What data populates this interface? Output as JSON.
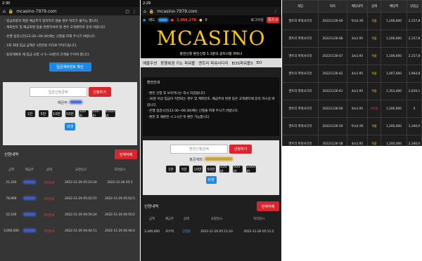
{
  "panel1": {
    "status_time": "2:30",
    "url": "mcasino-7979.com",
    "notice_lines": [
      "- 입금자명과 회원 예금주가 일치하지 않을 경우 처리가 불가능 합니다.",
      "- 계좌번호 및 예금자명 등을 변경하셔야 할 경우 고객센터로 문의 바랍니다.",
      "",
      "- 은행 점검시간(23:30~00:30)에는 신청을 피해 주시기 바랍니다.",
      "",
      "- 1회 최대 입금 금액은 1천만원 이하로 부탁드립니다.",
      "",
      "- 동일계좌로 재 입금 요청 시 5~10분의 간격을 두어야 합니다."
    ],
    "account_button": "입금계좌번호 확인",
    "amount_placeholder": "입금신청금액",
    "apply_button": "신청하기",
    "holder_label": "예금주:",
    "amount_buttons": [
      "1만",
      "5만",
      "10만",
      "50만",
      "100만",
      "500만",
      "1000만"
    ],
    "reset_button": "리셋",
    "history_title": "신청내역",
    "delete_all_button": "전체삭제",
    "columns": [
      "금액",
      "예금주",
      "상태",
      "요청일시",
      "처리일시"
    ],
    "rows": [
      {
        "amount": "21,160",
        "status": "처리완료",
        "requested": "2022-11-26 05:10:24",
        "processed": "2022-11-26 05:1"
      },
      {
        "amount": "78,966",
        "status": "처리완료",
        "requested": "2022-11-26 05:02:51",
        "processed": "2022-11-26 05:02:5"
      },
      {
        "amount": "22,100",
        "status": "처리완료",
        "requested": "2022-11-26 04:50:24",
        "processed": "2022-11-26 04:50:2"
      },
      {
        "amount": "3,000,000",
        "status": "처리완료",
        "requested": "2022-11-26 04:44:11",
        "processed": "2022-11-26 04:44:4"
      }
    ]
  },
  "panel2": {
    "status_time": "2:29",
    "url": "mcasino-7979.com",
    "user_label": "배드",
    "points": "3,004,276",
    "coin": "0",
    "logout": "로그아웃",
    "msg_badge": "쪽지 0",
    "logo": "MCASINO",
    "sub_banner": "충전신청 환전신청 1:1문의 공지사항 파트너",
    "menu": [
      "예울우션",
      "동행복권 키노 파워볼",
      "엔트리 파워사다리",
      "EOS파워볼3",
      "EO"
    ],
    "section_title": "환전안내",
    "notice_lines": [
      "- 환전 신청 후 보유머니는 즉시 차감됩니다.",
      "- 30분 이상 입금이 지연되는 경우 및 계좌번호, 예금주의 변경 등은 고객센터에 문의 하시길 바랍니다.",
      "- 은행 점검시간(23:30~00:30)에는 신청을 피해 주시기 바랍니다.",
      "- 환전 후 재환전 시 1시간 뒤 환전 가능합니다."
    ],
    "amount_placeholder": "환전신청금액",
    "apply_button": "신청하기",
    "account_label": "출금계좌:",
    "amount_buttons": [
      "1만",
      "5만",
      "10만",
      "50만",
      "100만",
      "500만",
      "1000만"
    ],
    "reset_button": "리셋",
    "history_title": "신청내역",
    "delete_all_button": "전체삭제",
    "columns": [
      "금액",
      "예금주",
      "상태",
      "요청일시",
      "처리일시"
    ],
    "rows": [
      {
        "amount": "3,340,000",
        "holder": "조수혁",
        "status": "신청중",
        "requested": "2022-11-26 05:11:43",
        "processed": "2022-11-26 05:11:5"
      }
    ]
  },
  "panel3": {
    "columns": [
      "게임",
      "회차",
      "배팅내역",
      "상태",
      "배팅액",
      "당첨금"
    ],
    "rows": [
      {
        "game": "엔트리 파워사다리",
        "round": "20221126-69",
        "bet": "우/x1.95",
        "status": "적중",
        "stake": "1,106,600",
        "win": "2,157,8"
      },
      {
        "game": "엔트리 파워사다리",
        "round": "20221126-68",
        "bet": "3/x1.95",
        "status": "적중",
        "stake": "1,106,600",
        "win": "2,157,8"
      },
      {
        "game": "엔트리 파워사다리",
        "round": "20221126-67",
        "bet": "3/x1.95",
        "status": "적중",
        "stake": "1,106,600",
        "win": "2,157,8"
      },
      {
        "game": "엔트리 파워사다리",
        "round": "20221126-62",
        "bet": "4/x1.95",
        "status": "적중",
        "stake": "1,007,600",
        "win": "1,964,8"
      },
      {
        "game": "엔트리 파워사다리",
        "round": "20221126-61",
        "bet": "4/x1.95",
        "status": "적중",
        "stake": "1,353,400",
        "win": "2,639,1"
      },
      {
        "game": "엔트리 파워사다리",
        "round": "20221126-60",
        "bet": "4/x1.95",
        "status": "미적중",
        "stake": "1,206,900",
        "win": "0"
      },
      {
        "game": "엔트리 파워사다리",
        "round": "20221126-59",
        "bet": "우/x1.95",
        "status": "적중",
        "stake": "1,200,000",
        "win": "2,340,0"
      },
      {
        "game": "엔트리 파워사다리",
        "round": "20221126-58",
        "bet": "4/x1.95",
        "status": "적중",
        "stake": "1,200,000",
        "win": "2,340,0"
      }
    ]
  },
  "colors": {
    "accent_red": "#d9262c",
    "accent_blue": "#1e88e5",
    "hit_yellow": "#ffd400",
    "miss_red": "#ff3b30"
  }
}
